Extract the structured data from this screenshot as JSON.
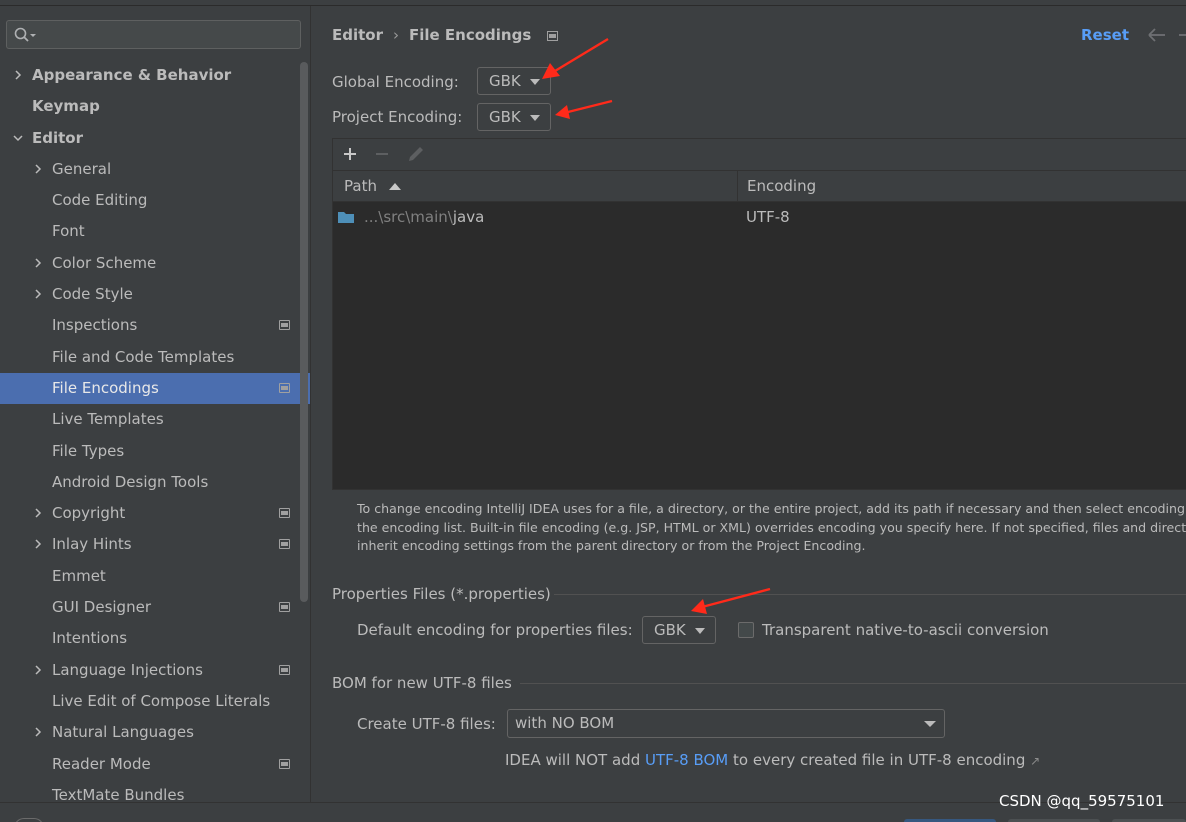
{
  "search": {
    "placeholder": ""
  },
  "sidebar": {
    "items": [
      {
        "label": "Appearance & Behavior",
        "level": 0,
        "chevron": "right",
        "bold": true,
        "badge": false,
        "selected": false
      },
      {
        "label": "Keymap",
        "level": 0,
        "chevron": "none",
        "bold": true,
        "badge": false,
        "selected": false
      },
      {
        "label": "Editor",
        "level": 0,
        "chevron": "down",
        "bold": true,
        "badge": false,
        "selected": false
      },
      {
        "label": "General",
        "level": 1,
        "chevron": "right",
        "bold": false,
        "badge": false,
        "selected": false
      },
      {
        "label": "Code Editing",
        "level": 1,
        "chevron": "none",
        "bold": false,
        "badge": false,
        "selected": false
      },
      {
        "label": "Font",
        "level": 1,
        "chevron": "none",
        "bold": false,
        "badge": false,
        "selected": false
      },
      {
        "label": "Color Scheme",
        "level": 1,
        "chevron": "right",
        "bold": false,
        "badge": false,
        "selected": false
      },
      {
        "label": "Code Style",
        "level": 1,
        "chevron": "right",
        "bold": false,
        "badge": false,
        "selected": false
      },
      {
        "label": "Inspections",
        "level": 1,
        "chevron": "none",
        "bold": false,
        "badge": true,
        "selected": false
      },
      {
        "label": "File and Code Templates",
        "level": 1,
        "chevron": "none",
        "bold": false,
        "badge": false,
        "selected": false
      },
      {
        "label": "File Encodings",
        "level": 1,
        "chevron": "none",
        "bold": false,
        "badge": true,
        "selected": true
      },
      {
        "label": "Live Templates",
        "level": 1,
        "chevron": "none",
        "bold": false,
        "badge": false,
        "selected": false
      },
      {
        "label": "File Types",
        "level": 1,
        "chevron": "none",
        "bold": false,
        "badge": false,
        "selected": false
      },
      {
        "label": "Android Design Tools",
        "level": 1,
        "chevron": "none",
        "bold": false,
        "badge": false,
        "selected": false
      },
      {
        "label": "Copyright",
        "level": 1,
        "chevron": "right",
        "bold": false,
        "badge": true,
        "selected": false
      },
      {
        "label": "Inlay Hints",
        "level": 1,
        "chevron": "right",
        "bold": false,
        "badge": true,
        "selected": false
      },
      {
        "label": "Emmet",
        "level": 1,
        "chevron": "none",
        "bold": false,
        "badge": false,
        "selected": false
      },
      {
        "label": "GUI Designer",
        "level": 1,
        "chevron": "none",
        "bold": false,
        "badge": true,
        "selected": false
      },
      {
        "label": "Intentions",
        "level": 1,
        "chevron": "none",
        "bold": false,
        "badge": false,
        "selected": false
      },
      {
        "label": "Language Injections",
        "level": 1,
        "chevron": "right",
        "bold": false,
        "badge": true,
        "selected": false
      },
      {
        "label": "Live Edit of Compose Literals",
        "level": 1,
        "chevron": "none",
        "bold": false,
        "badge": false,
        "selected": false
      },
      {
        "label": "Natural Languages",
        "level": 1,
        "chevron": "right",
        "bold": false,
        "badge": false,
        "selected": false
      },
      {
        "label": "Reader Mode",
        "level": 1,
        "chevron": "none",
        "bold": false,
        "badge": true,
        "selected": false
      },
      {
        "label": "TextMate Bundles",
        "level": 1,
        "chevron": "none",
        "bold": false,
        "badge": false,
        "selected": false
      }
    ]
  },
  "header": {
    "crumb_parent": "Editor",
    "crumb_sep": "›",
    "crumb_current": "File Encodings",
    "reset_label": "Reset"
  },
  "encodings": {
    "global_label": "Global Encoding:",
    "global_value": "GBK",
    "project_label": "Project Encoding:",
    "project_value": "GBK"
  },
  "table": {
    "toolbar": {
      "add": "+",
      "remove": "−"
    },
    "columns": [
      {
        "label": "Path",
        "sort": "ascending"
      },
      {
        "label": "Encoding"
      }
    ],
    "rows": [
      {
        "path_prefix": "...\\src\\main\\",
        "path_name": "java",
        "encoding": "UTF-8"
      }
    ]
  },
  "hint": {
    "line1": "To change encoding IntelliJ IDEA uses for a file, a directory, or the entire project, add its path if necessary and then select encoding from",
    "line2": "the encoding list. Built-in file encoding (e.g. JSP, HTML or XML) overrides encoding you specify here. If not specified, files and directories",
    "line3": "inherit encoding settings from the parent directory or from the Project Encoding."
  },
  "properties": {
    "section_title": "Properties Files (*.properties)",
    "default_label": "Default encoding for properties files:",
    "default_value": "GBK",
    "transparent_label": "Transparent native-to-ascii conversion",
    "transparent_checked": false
  },
  "bom": {
    "section_title": "BOM for new UTF-8 files",
    "create_label": "Create UTF-8 files:",
    "create_value": "with NO BOM",
    "note_prefix": "IDEA will NOT add ",
    "note_link": "UTF-8 BOM",
    "note_suffix": " to every created file in UTF-8 encoding",
    "note_arrow": "↗"
  },
  "watermark": "CSDN @qq_59575101",
  "colors": {
    "background": "#3c3f41",
    "selection": "#4b6eaf",
    "link": "#589df6",
    "annotation_arrow": "#ff2a1a",
    "folder": "#4e8fb8"
  }
}
